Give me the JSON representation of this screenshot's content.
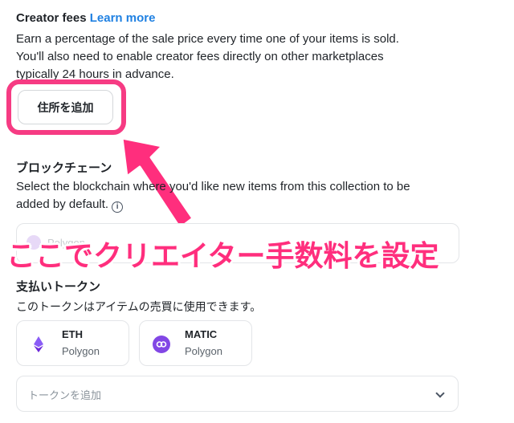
{
  "creator_fees": {
    "title": "Creator fees",
    "learn_more": "Learn more",
    "description_line1": "Earn a percentage of the sale price every time one of your items is sold.",
    "description_line2": "You'll also need to enable creator fees directly on other marketplaces",
    "description_line3": "typically 24 hours in advance.",
    "add_address_button": "住所を追加"
  },
  "blockchain": {
    "title": "ブロックチェーン",
    "description_line1": "Select the blockchain where you'd like new items from this collection to be",
    "description_line2": "added by default.",
    "selected": "Polygon"
  },
  "annotation": {
    "text": "ここでクリエイター手数料を設定",
    "color": "#ff2e7d"
  },
  "payment_tokens": {
    "title": "支払いトークン",
    "description": "このトークンはアイテムの売買に使用できます。",
    "tokens": [
      {
        "symbol": "ETH",
        "network": "Polygon",
        "icon": "ethereum-icon"
      },
      {
        "symbol": "MATIC",
        "network": "Polygon",
        "icon": "polygon-icon"
      }
    ],
    "add_token_placeholder": "トークンを追加"
  }
}
